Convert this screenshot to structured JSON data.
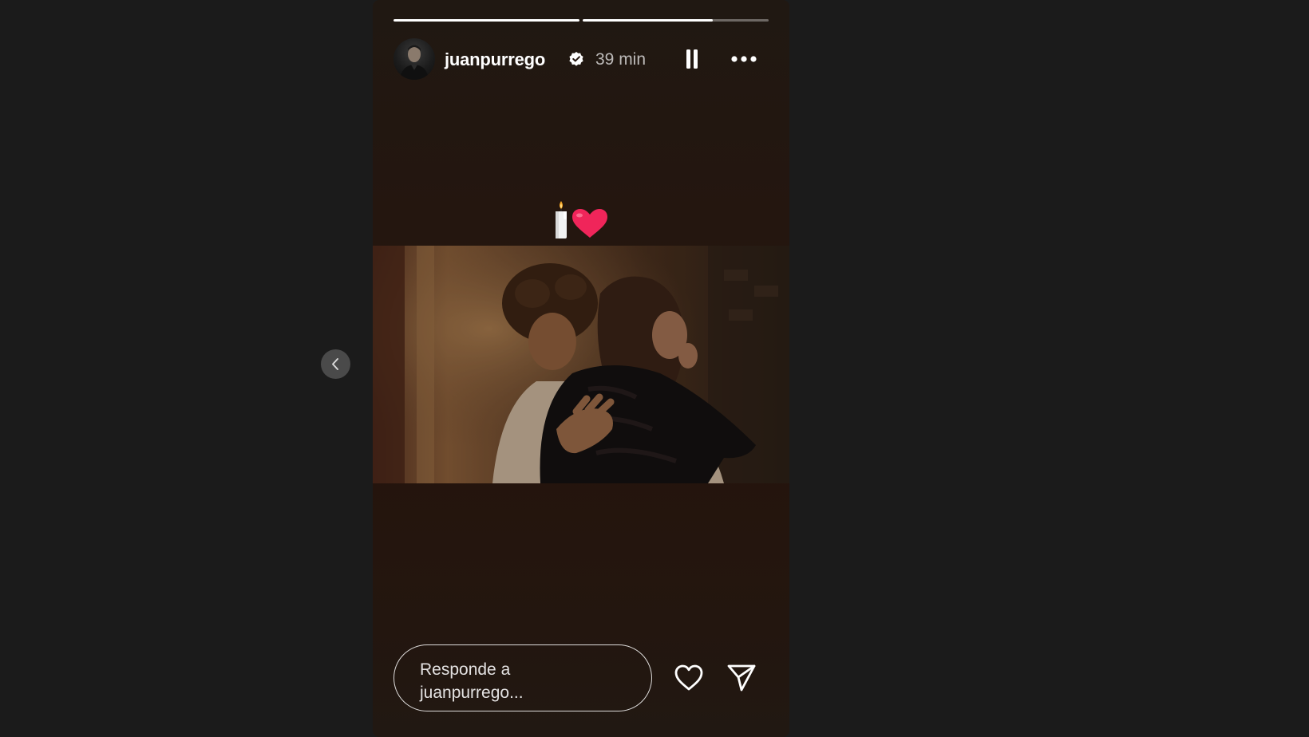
{
  "story": {
    "progress": [
      1.0,
      0.7
    ],
    "author": {
      "username": "juanpurrego",
      "verified": true,
      "time_ago": "39 min"
    },
    "controls": {
      "pause_icon": "pause-icon",
      "more_icon": "more-icon"
    },
    "sticker_emojis": "🕯️❤️",
    "reply": {
      "placeholder": "Responde a juanpurrego...",
      "line1": "Responde a",
      "line2": "juanpurrego..."
    },
    "actions": {
      "like_icon": "heart-icon",
      "share_icon": "send-icon"
    }
  },
  "navigation": {
    "previous_icon": "chevron-left-icon"
  },
  "colors": {
    "page_bg": "#1b1b1b",
    "story_bg": "#24160f",
    "text": "#ffffff",
    "muted_text": "#b3b3b3",
    "heart_red": "#f0255a"
  }
}
